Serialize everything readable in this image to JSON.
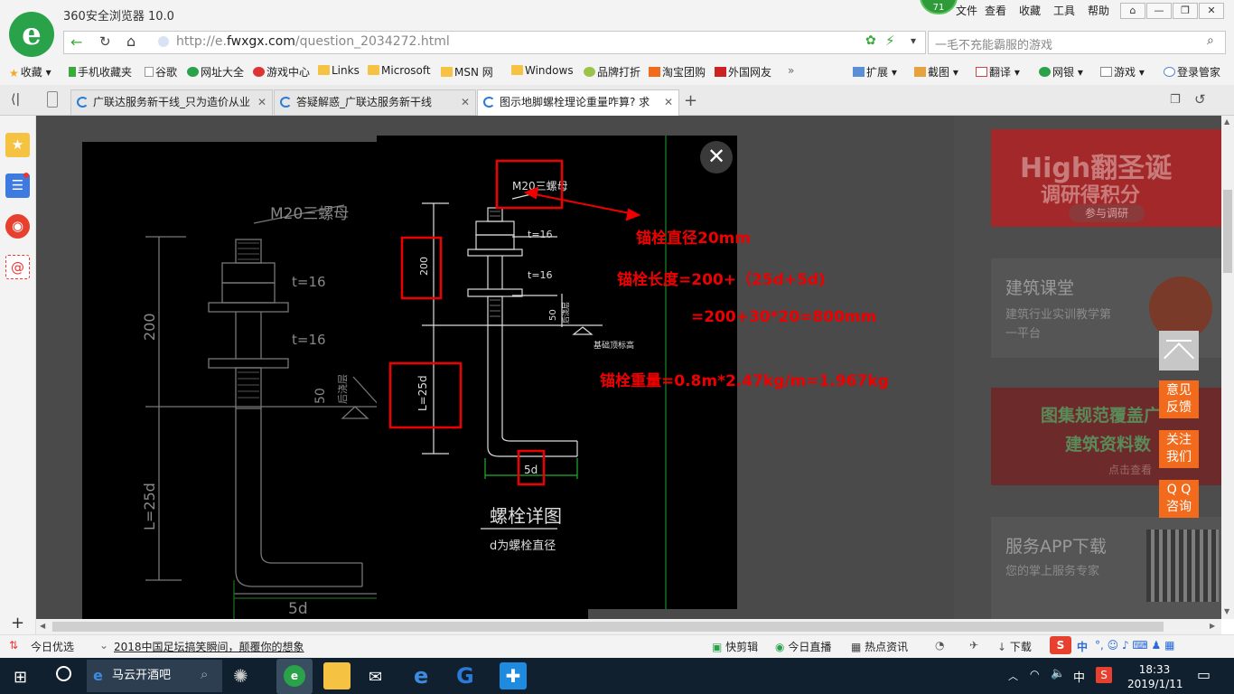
{
  "browser": {
    "title": "360安全浏览器 10.0",
    "badge": "71",
    "menus": [
      "文件",
      "查看",
      "收藏",
      "工具",
      "帮助"
    ],
    "url_prefix": "http://e.",
    "url_domain": "fwxgx.com",
    "url_path": "/question_2034272.html",
    "search_placeholder": "一毛不充能霸服的游戏"
  },
  "bookmarks": {
    "left": [
      "收藏",
      "手机收藏夹",
      "谷歌",
      "网址大全",
      "游戏中心",
      "Links",
      "Microsoft",
      "MSN 网",
      "Windows",
      "品牌打折",
      "淘宝团购",
      "外国网友"
    ],
    "more": "»",
    "right": [
      "扩展",
      "截图",
      "翻译",
      "网银",
      "游戏",
      "登录管家"
    ]
  },
  "tabs": [
    {
      "label": "广联达服务新干线_只为造价从业"
    },
    {
      "label": "答疑解惑_广联达服务新干线"
    },
    {
      "label": "图示地脚螺栓理论重量咋算? 求"
    }
  ],
  "tab_new": "+",
  "drawing": {
    "nut_label": "M20三螺母",
    "t1": "t=16",
    "t2": "t=16",
    "dim200": "200",
    "dim50": "50",
    "dim_text_small": "后浇层",
    "base_label": "基础顶标高",
    "L_label": "L=25d",
    "five_d": "5d",
    "detail_title": "螺栓详图",
    "detail_sub": "d为螺栓直径"
  },
  "annotations": {
    "line1": "锚栓直径20mm",
    "line2": "锚栓长度=200+（25d+5d)",
    "line3": "=200+30*20=800mm",
    "line4": "锚栓重量=0.8m*2.47kg/m=1.967kg"
  },
  "right_panel": {
    "ad1_title": "High翻圣诞",
    "ad1_sub": "调研得积分",
    "ad1_btn": "参与调研",
    "course_title": "建筑课堂",
    "course_desc": "建筑行业实训教学第一平台",
    "ad2_title": "图集规范覆盖广",
    "ad2_sub": "建筑资料数",
    "ad2_btn": "点击查看",
    "app_title": "服务APP下载",
    "app_desc": "您的掌上服务专家"
  },
  "float_buttons": [
    "意见反馈",
    "关注我们",
    "Q Q咨询"
  ],
  "statusbar": {
    "today": "今日优选",
    "news": "2018中国足坛搞笑瞬间，颠覆你的想象",
    "items": [
      "快剪辑",
      "今日直播",
      "热点资讯",
      "下载"
    ],
    "ime": "中"
  },
  "taskbar": {
    "search_text": "马云开酒吧",
    "ime": "中",
    "time": "18:33",
    "date": "2019/1/11"
  },
  "colors": {
    "accent_green": "#2aa24a",
    "annotation_red": "#e00000",
    "float_orange": "#f26b1d"
  }
}
